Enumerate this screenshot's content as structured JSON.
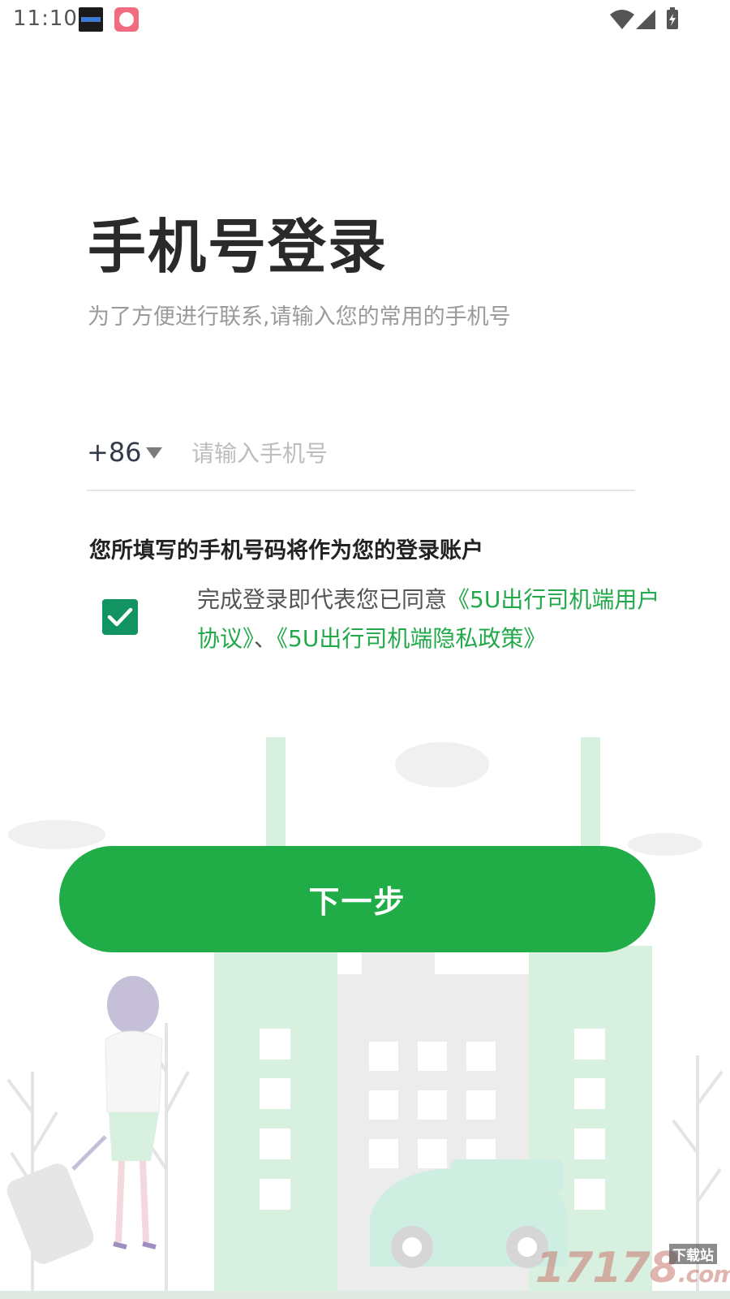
{
  "status_bar": {
    "time": "11:10",
    "icons": [
      "clock-app-icon",
      "recorder-app-icon",
      "wifi-icon",
      "signal-icon",
      "battery-icon"
    ]
  },
  "login": {
    "title": "手机号登录",
    "subtitle": "为了方便进行联系,请输入您的常用的手机号",
    "country_code": "+86",
    "phone_placeholder": "请输入手机号",
    "phone_value": "",
    "account_note": "您所填写的手机号码将作为您的登录账户",
    "agreement": {
      "checked": true,
      "prefix": "完成登录即代表您已同意",
      "user_agreement": "《5U出行司机端用户协议》",
      "separator": "、",
      "privacy_policy": "《5U出行司机端隐私政策》"
    },
    "next_button": "下一步"
  },
  "watermark": {
    "text": "17178",
    "suffix": ".com",
    "tag": "下载站"
  },
  "colors": {
    "accent": "#20ad48",
    "checkbox": "#129462",
    "link": "#22a94a",
    "illustration_green": "#d8f0df"
  }
}
